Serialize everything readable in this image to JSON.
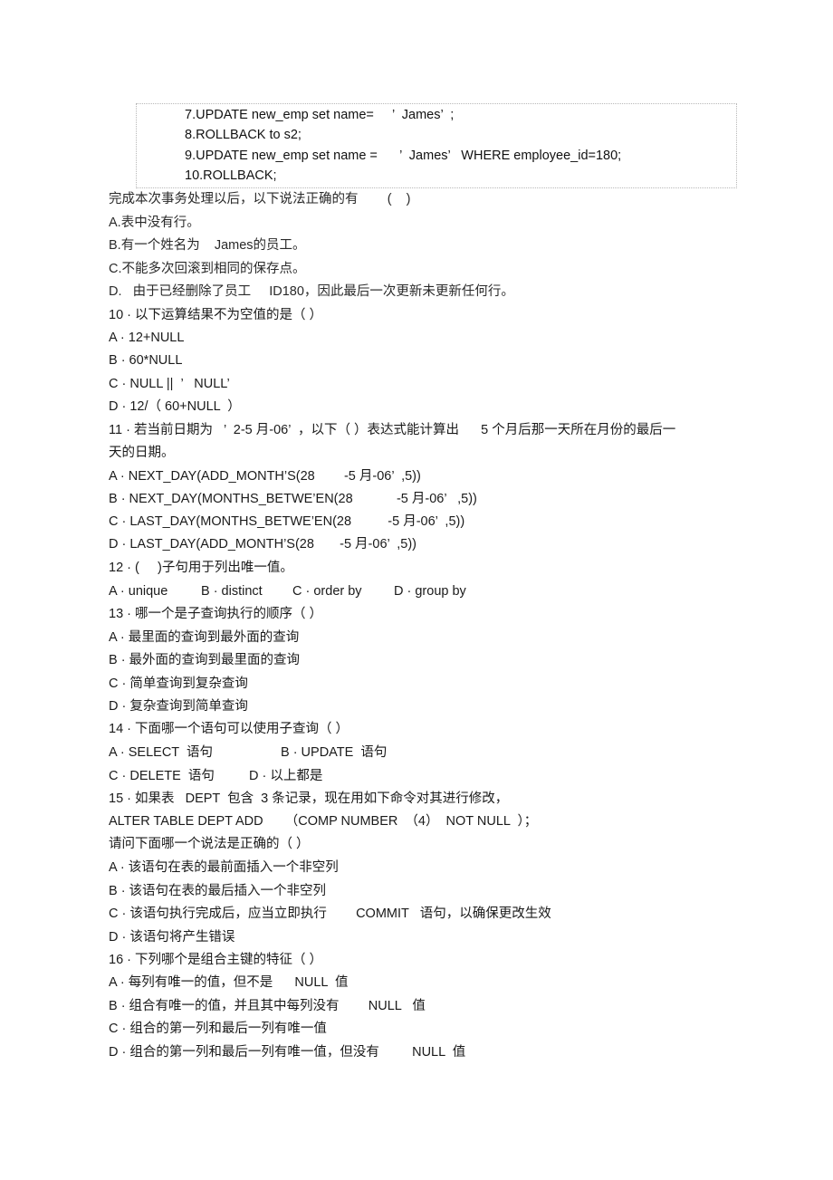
{
  "code_block": {
    "lines": [
      "7.UPDATE new_emp set name=     ’  James’  ;",
      "8.ROLLBACK to s2;",
      "9.UPDATE new_emp set name =      ’  James’   WHERE employee_id=180;",
      "10.ROLLBACK;"
    ]
  },
  "q9_tail": {
    "prompt": "完成本次事务处理以后，以下说法正确的有        (    )",
    "options": [
      "A.表中没有行。",
      "B.有一个姓名为    James的员工。",
      "C.不能多次回滚到相同的保存点。",
      "D.   由于已经删除了员工     ID180，因此最后一次更新未更新任何行。"
    ]
  },
  "q10": {
    "prompt": "10 · 以下运算结果不为空值的是（ ）",
    "options": [
      "A · 12+NULL",
      "B · 60*NULL",
      "C · NULL ||  ’   NULL’",
      "D · 12/（ 60+NULL  ）"
    ]
  },
  "q11": {
    "prompt_line1": "11 · 若当前日期为   ’  2-5 月-06’  ，以下（ ）表达式能计算出      5 个月后那一天所在月份的最后一",
    "prompt_line2": "天的日期。",
    "options": [
      "A · NEXT_DAY(ADD_MONTH’S(28        -5 月-06’  ,5))",
      "B · NEXT_DAY(MONTHS_BETWE’EN(28            -5 月-06’   ,5))",
      "C · LAST_DAY(MONTHS_BETWE’EN(28          -5 月-06’  ,5))",
      "D · LAST_DAY(ADD_MONTH’S(28       -5 月-06’  ,5))"
    ]
  },
  "q12": {
    "prompt": "12 · (     )子句用于列出唯一值。",
    "options": [
      "A · unique",
      "B · distinct",
      "C · order by",
      "D · group by"
    ]
  },
  "q13": {
    "prompt": "13 · 哪一个是子查询执行的顺序（ ）",
    "options": [
      "A · 最里面的查询到最外面的查询",
      "B · 最外面的查询到最里面的查询",
      "C · 简单查询到复杂查询",
      "D · 复杂查询到简单查询"
    ]
  },
  "q14": {
    "prompt": "14 · 下面哪一个语句可以使用子查询（ ）",
    "options": [
      "A · SELECT  语句",
      "B · UPDATE  语句",
      "C · DELETE  语句",
      "D · 以上都是"
    ]
  },
  "q15": {
    "prompt": "15 · 如果表   DEPT  包含  3 条记录，现在用如下命令对其进行修改，",
    "statement": "ALTER TABLE DEPT ADD      （COMP NUMBER  （4）  NOT NULL  ）；",
    "question": "请问下面哪一个说法是正确的（ ）",
    "options": [
      "A · 该语句在表的最前面插入一个非空列",
      "B · 该语句在表的最后插入一个非空列",
      "C · 该语句执行完成后，应当立即执行        COMMIT   语句，以确保更改生效",
      "D · 该语句将产生错误"
    ]
  },
  "q16": {
    "prompt": "16 · 下列哪个是组合主键的特征（ ）",
    "options": [
      "A · 每列有唯一的值，但不是      NULL  值",
      "B · 组合有唯一的值，并且其中每列没有        NULL   值",
      "C · 组合的第一列和最后一列有唯一值",
      "D · 组合的第一列和最后一列有唯一值，但没有         NULL  值"
    ]
  }
}
